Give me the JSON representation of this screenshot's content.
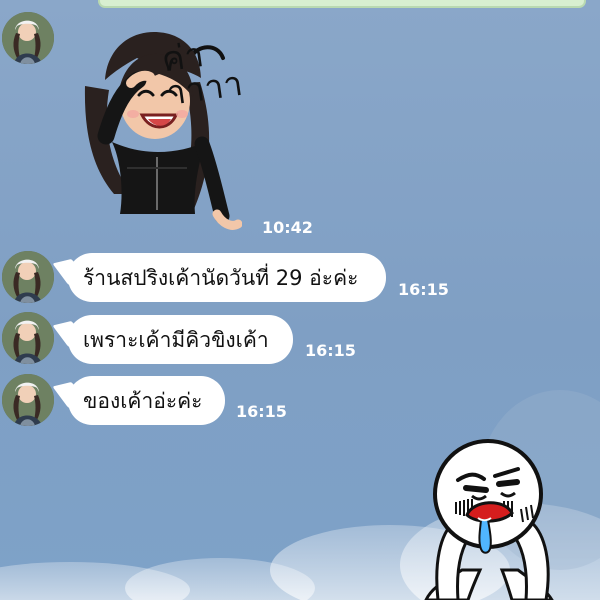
{
  "chat": {
    "sticker_message": {
      "text": "ค่าาาาา",
      "time": "10:42"
    },
    "messages": [
      {
        "text": "ร้านสปริงเค้านัดวันที่ 29 อ่ะค่ะ",
        "time": "16:15"
      },
      {
        "text": "เพราะเค้ามีคิวขิงเค้า",
        "time": "16:15"
      },
      {
        "text": "ของเค้าอ่ะค่ะ",
        "time": "16:15"
      }
    ]
  },
  "colors": {
    "background": "#8aa7c9",
    "bubble": "#ffffff",
    "timestamp": "#ffffff"
  },
  "icons": {
    "avatar": "profile-avatar-icon",
    "sticker_girl": "girl-salute-sticker-icon",
    "sticker_moon": "sad-moon-sticker-icon"
  }
}
